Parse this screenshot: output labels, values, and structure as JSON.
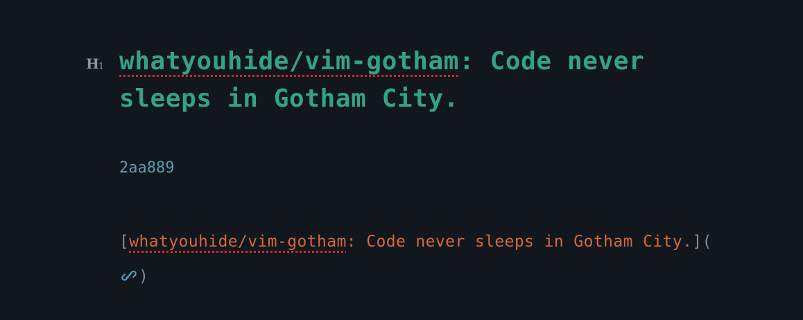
{
  "heading": {
    "level_marker": "H",
    "level_number": "1",
    "part1": "whatyouhide/vim-gotham",
    "part2": ": Code never sleeps in Gotham City."
  },
  "commit_hash": "2aa889",
  "link": {
    "open_bracket": "[",
    "part1": "whatyouhide/vim-gotham",
    "part2": ": Code never sleeps in Gotham City.",
    "close_bracket": "]",
    "open_paren": "(",
    "close_paren": ")",
    "icon": "link-icon"
  },
  "colors": {
    "background": "#12161d",
    "heading": "#33a386",
    "hash": "#5b9bb4",
    "link_text": "#d26a3c",
    "spell_underline": "#cf2b2b",
    "marker": "#8a93a2"
  }
}
